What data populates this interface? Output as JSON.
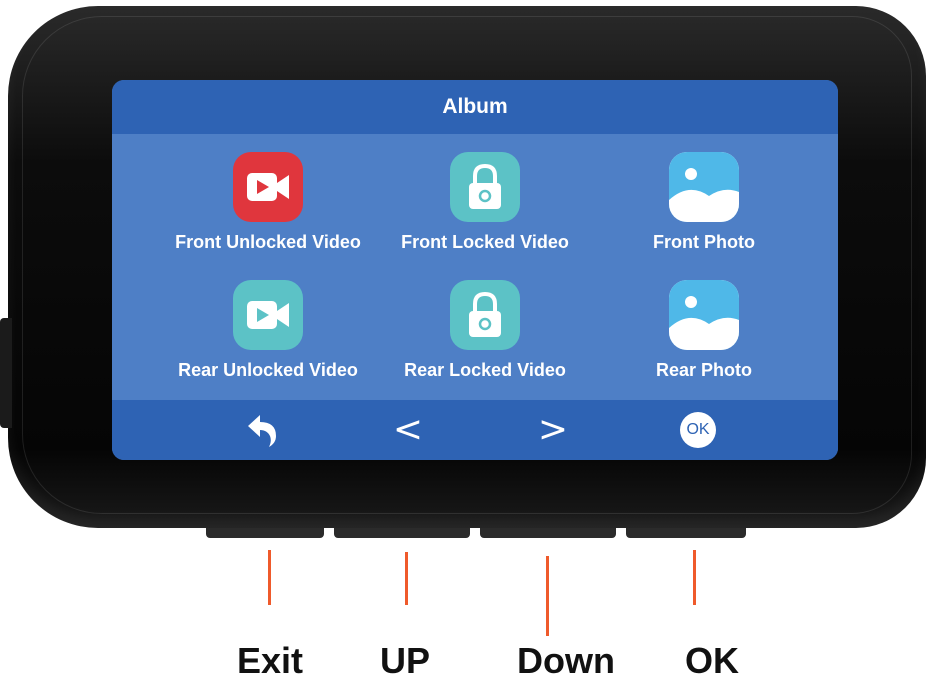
{
  "screen": {
    "title": "Album",
    "tiles": [
      {
        "label": "Front Unlocked Video",
        "icon": "video-camera-icon",
        "color": "#e0363d"
      },
      {
        "label": "Front Locked Video",
        "icon": "padlock-icon",
        "color": "#5cc2c6"
      },
      {
        "label": "Front Photo",
        "icon": "photo-icon",
        "color": "#ffffff"
      },
      {
        "label": "Rear Unlocked Video",
        "icon": "video-camera-icon",
        "color": "#5cc2c6"
      },
      {
        "label": "Rear Locked Video",
        "icon": "padlock-icon",
        "color": "#5cc2c6"
      },
      {
        "label": "Rear Photo",
        "icon": "photo-icon",
        "color": "#ffffff"
      }
    ],
    "nav": {
      "back_icon": "undo-arrow-icon",
      "prev_glyph": "<",
      "next_glyph": ">",
      "ok_label": "OK"
    },
    "colors": {
      "bar": "#2e63b4",
      "background": "#4e7fc6",
      "callout": "#ef5a2b"
    }
  },
  "callouts": {
    "exit": "Exit",
    "up": "UP",
    "down": "Down",
    "ok": "OK"
  }
}
